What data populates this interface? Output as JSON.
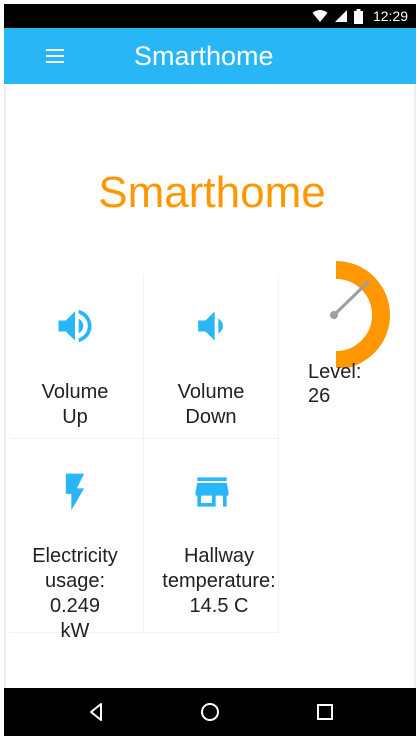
{
  "status_bar": {
    "time": "12:29",
    "icons": [
      "wifi-icon",
      "cell-signal-icon",
      "battery-icon"
    ]
  },
  "app_bar": {
    "title": "Smarthome",
    "menu_icon": "menu-icon",
    "color": "#29b6f6"
  },
  "main": {
    "heading": "Smarthome",
    "heading_color": "#ff9800",
    "tiles": [
      {
        "label": "Volume\nUp",
        "icon": "volume-up-icon"
      },
      {
        "label": "Volume\nDown",
        "icon": "volume-down-icon"
      },
      {
        "label": "Electricity\nusage:\n0.249\nkW",
        "icon": "lightning-icon"
      },
      {
        "label": "Hallway\ntemperature:\n14.5 C",
        "icon": "store-icon"
      }
    ],
    "gauge": {
      "label": "Level:\n26",
      "value": 26,
      "accent": "#ff9800"
    },
    "icon_color": "#29b6f6"
  },
  "nav_bar": {
    "buttons": [
      "back-icon",
      "home-icon",
      "recents-icon"
    ]
  }
}
